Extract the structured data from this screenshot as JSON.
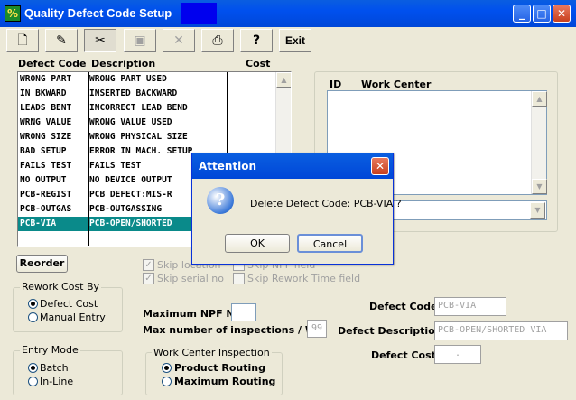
{
  "window": {
    "title": "Quality Defect Code Setup",
    "icon": "app-icon"
  },
  "toolbar": {
    "new_icon": "new-document-icon",
    "edit_icon": "edit-icon",
    "cut_icon": "scissors-icon",
    "save_icon": "save-icon",
    "delete_icon": "x-icon",
    "print_icon": "printer-icon",
    "help_label": "?",
    "exit_label": "Exit"
  },
  "list": {
    "headers": [
      "Defect Code",
      "Description",
      "Cost"
    ],
    "rows": [
      [
        "WRONG PART",
        "WRONG PART USED"
      ],
      [
        "IN BKWARD",
        "INSERTED BACKWARD"
      ],
      [
        "LEADS BENT",
        "INCORRECT LEAD BEND"
      ],
      [
        "WRNG VALUE",
        "WRONG VALUE USED"
      ],
      [
        "WRONG SIZE",
        "WRONG PHYSICAL SIZE"
      ],
      [
        "BAD SETUP",
        "ERROR IN MACH. SETUP"
      ],
      [
        "FAILS TEST",
        "FAILS TEST"
      ],
      [
        "NO OUTPUT",
        "NO DEVICE OUTPUT"
      ],
      [
        "PCB-REGIST",
        "PCB DEFECT:MIS-R"
      ],
      [
        "PCB-OUTGAS",
        "PCB-OUTGASSING"
      ],
      [
        "PCB-VIA",
        "PCB-OPEN/SHORTED"
      ]
    ],
    "selected_index": 10
  },
  "work_center": {
    "headers": [
      "ID",
      "Work Center"
    ]
  },
  "reorder_label": "Reorder",
  "rework_cost": {
    "title": "Rework Cost By",
    "options": [
      "Defect Cost",
      "Manual Entry"
    ],
    "selected": "Defect Cost"
  },
  "entry_mode": {
    "title": "Entry Mode",
    "options": [
      "Batch",
      "In-Line"
    ],
    "selected": "Batch"
  },
  "checkboxes": {
    "skip_location": "Skip location",
    "skip_serial": "Skip serial no",
    "skip_npf": "Skip NPF field",
    "skip_rework": "Skip Rework Time field"
  },
  "npf": {
    "max_npf_label": "Maximum NPF No",
    "max_npf_value": "",
    "max_insp_label": "Max number of inspections / WC",
    "max_insp_value": "99"
  },
  "wc_inspection": {
    "title": "Work Center Inspection",
    "options": [
      "Product Routing",
      "Maximum Routing"
    ],
    "selected": "Product Routing"
  },
  "details": {
    "code_label": "Defect Code",
    "code_value": "PCB-VIA",
    "desc_label": "Defect Description",
    "desc_value": "PCB-OPEN/SHORTED VIA",
    "cost_label": "Defect Cost",
    "cost_value": "."
  },
  "dialog": {
    "title": "Attention",
    "message": "Delete Defect Code: PCB-VIA ?",
    "ok_label": "OK",
    "cancel_label": "Cancel",
    "icon": "question-icon"
  }
}
